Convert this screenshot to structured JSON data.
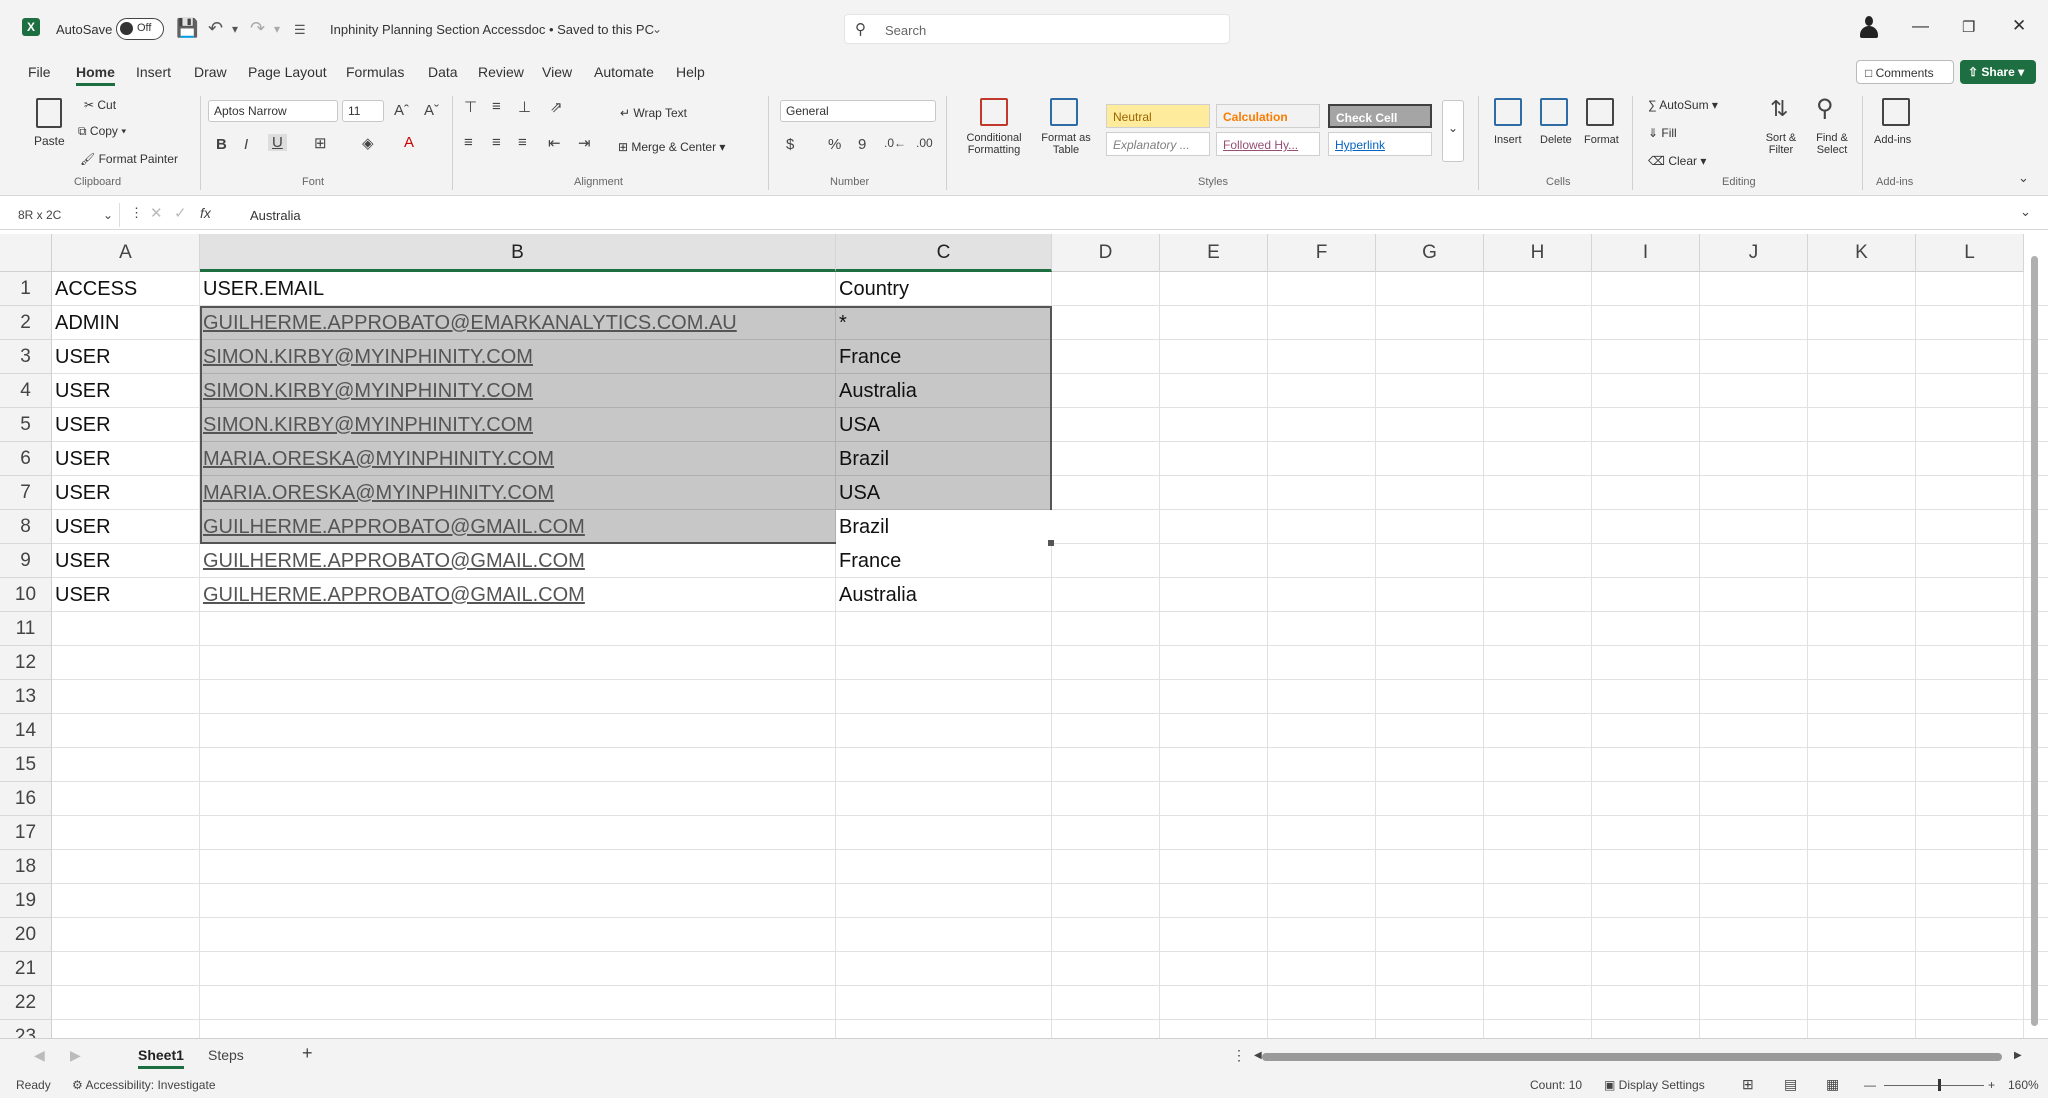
{
  "titlebar": {
    "autosave_label": "AutoSave",
    "autosave_state": "Off",
    "document_title": "Inphinity Planning Section Accessdoc • Saved to this PC",
    "search_placeholder": "Search"
  },
  "ribbon_tabs": [
    "File",
    "Home",
    "Insert",
    "Draw",
    "Page Layout",
    "Formulas",
    "Data",
    "Review",
    "View",
    "Automate",
    "Help"
  ],
  "active_tab": "Home",
  "actions": {
    "comments": "Comments",
    "share": "Share"
  },
  "ribbon": {
    "clipboard": {
      "paste": "Paste",
      "cut": "Cut",
      "copy": "Copy",
      "format_painter": "Format Painter",
      "label": "Clipboard"
    },
    "font": {
      "name": "Aptos Narrow",
      "size": "11",
      "label": "Font"
    },
    "alignment": {
      "wrap_text": "Wrap Text",
      "merge_center": "Merge & Center",
      "label": "Alignment"
    },
    "number": {
      "format": "General",
      "label": "Number"
    },
    "styles": {
      "conditional_formatting": "Conditional Formatting",
      "format_as_table": "Format as Table",
      "cells": [
        "Neutral",
        "Calculation",
        "Check Cell",
        "Explanatory ...",
        "Followed Hy...",
        "Hyperlink"
      ],
      "label": "Styles"
    },
    "cells": {
      "insert": "Insert",
      "delete": "Delete",
      "format": "Format",
      "label": "Cells"
    },
    "editing": {
      "autosum": "AutoSum",
      "fill": "Fill",
      "clear": "Clear",
      "sort_filter": "Sort & Filter",
      "find_select": "Find & Select",
      "label": "Editing"
    },
    "addins": {
      "addins": "Add-ins",
      "label": "Add-ins"
    }
  },
  "formula_bar": {
    "name_box": "8R x 2C",
    "fx": "fx",
    "content": "Australia"
  },
  "columns": [
    "A",
    "B",
    "C",
    "D",
    "E",
    "F",
    "G",
    "H",
    "I",
    "J",
    "K",
    "L"
  ],
  "rows": [
    "1",
    "2",
    "3",
    "4",
    "5",
    "6",
    "7",
    "8",
    "9",
    "10",
    "11",
    "12",
    "13",
    "14",
    "15",
    "16",
    "17",
    "18",
    "19",
    "20",
    "21",
    "22",
    "23"
  ],
  "table": [
    {
      "access": "ACCESS",
      "email": "USER.EMAIL",
      "country": "Country"
    },
    {
      "access": "ADMIN",
      "email": "GUILHERME.APPROBATO@EMARKANALYTICS.COM.AU",
      "country": "*"
    },
    {
      "access": "USER",
      "email": "SIMON.KIRBY@MYINPHINITY.COM",
      "country": "France"
    },
    {
      "access": "USER",
      "email": "SIMON.KIRBY@MYINPHINITY.COM",
      "country": "Australia"
    },
    {
      "access": "USER",
      "email": "SIMON.KIRBY@MYINPHINITY.COM",
      "country": "USA"
    },
    {
      "access": "USER",
      "email": "MARIA.ORESKA@MYINPHINITY.COM",
      "country": "Brazil"
    },
    {
      "access": "USER",
      "email": "MARIA.ORESKA@MYINPHINITY.COM",
      "country": "USA"
    },
    {
      "access": "USER",
      "email": "GUILHERME.APPROBATO@GMAIL.COM",
      "country": "Brazil"
    },
    {
      "access": "USER",
      "email": "GUILHERME.APPROBATO@GMAIL.COM",
      "country": "France"
    },
    {
      "access": "USER",
      "email": "GUILHERME.APPROBATO@GMAIL.COM",
      "country": "Australia"
    }
  ],
  "sheets": [
    "Sheet1",
    "Steps"
  ],
  "active_sheet": "Sheet1",
  "status": {
    "ready": "Ready",
    "accessibility": "Accessibility: Investigate",
    "count": "Count: 10",
    "display_settings": "Display Settings",
    "zoom": "160%"
  },
  "colors": {
    "accent": "#1d6f42",
    "selection_fill": "#a7a7a7",
    "neutral_style": "#ffeb9c",
    "calculation_style": "#f2f2f2",
    "check_cell_style": "#a5a5a5"
  }
}
